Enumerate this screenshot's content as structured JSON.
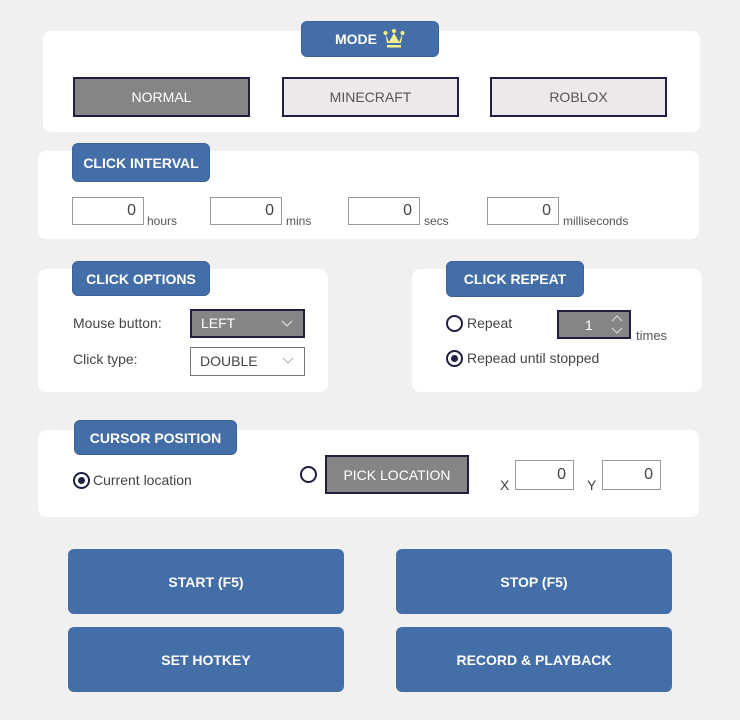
{
  "mode": {
    "title": "MODE",
    "title_icon": "crown-icon",
    "options": [
      {
        "label": "NORMAL",
        "selected": true
      },
      {
        "label": "MINECRAFT",
        "selected": false
      },
      {
        "label": "ROBLOX",
        "selected": false
      }
    ]
  },
  "click_interval": {
    "title": "CLICK INTERVAL",
    "fields": [
      {
        "value": "0",
        "unit": "hours"
      },
      {
        "value": "0",
        "unit": "mins"
      },
      {
        "value": "0",
        "unit": "secs"
      },
      {
        "value": "0",
        "unit": "milliseconds"
      }
    ]
  },
  "click_options": {
    "title": "CLICK OPTIONS",
    "mouse_button_label": "Mouse button:",
    "mouse_button_value": "LEFT",
    "click_type_label": "Click type:",
    "click_type_value": "DOUBLE"
  },
  "click_repeat": {
    "title": "CLICK REPEAT",
    "repeat_label": "Repeat",
    "repeat_selected": false,
    "repeat_count": "1",
    "times_label": "times",
    "until_stopped_label": "Repead until stopped",
    "until_stopped_selected": true
  },
  "cursor_position": {
    "title": "CURSOR POSITION",
    "current_location_label": "Current location",
    "current_location_selected": true,
    "pick_location_selected": false,
    "pick_location_button": "PICK LOCATION",
    "x_label": "X",
    "x_value": "0",
    "y_label": "Y",
    "y_value": "0"
  },
  "actions": {
    "start": "START (F5)",
    "stop": "STOP (F5)",
    "set_hotkey": "SET HOTKEY",
    "record_playback": "RECORD & PLAYBACK"
  },
  "colors": {
    "accent": "#446ea7",
    "selected_gray": "#858585",
    "crown": "#f5f08a",
    "background": "#f0f0f0"
  }
}
